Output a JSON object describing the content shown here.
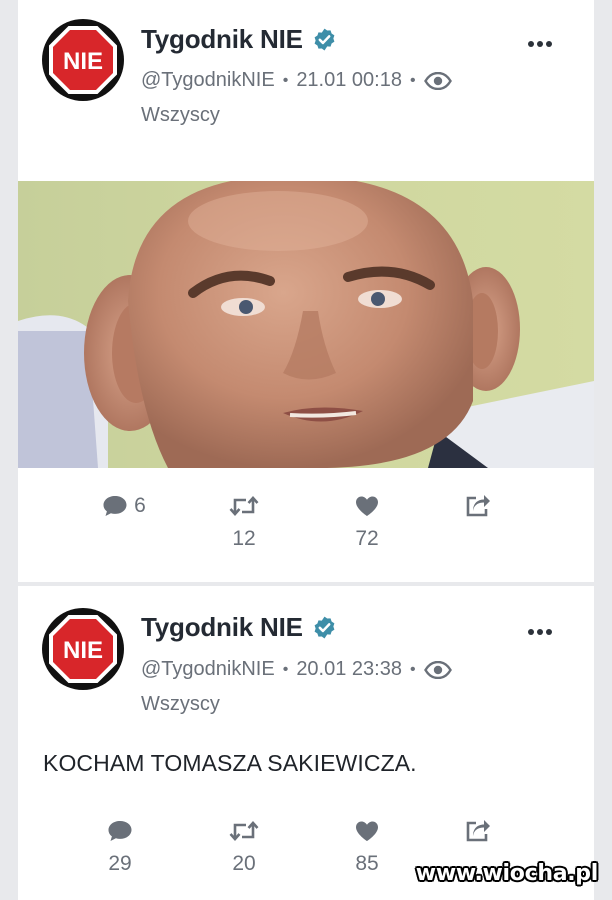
{
  "colors": {
    "background": "#e8e9ec",
    "card": "#ffffff",
    "verified": "#3e8ea8",
    "muted_text": "#6a7079",
    "name_text": "#242a33",
    "stop_sign_red": "#d8262a"
  },
  "posts": [
    {
      "author": "Tygodnik NIE",
      "avatar_text": "NIE",
      "verified_icon": "verified-badge-icon",
      "handle": "@TygodnikNIE",
      "separator": "•",
      "timestamp": "21.01 00:18",
      "visibility_icon": "eye-icon",
      "audience": "Wszyscy",
      "more_icon": "more-dots-icon",
      "media": "photo of a bald man with large ears",
      "actions": {
        "comments": "6",
        "reposts": "12",
        "likes": "72"
      }
    },
    {
      "author": "Tygodnik NIE",
      "avatar_text": "NIE",
      "verified_icon": "verified-badge-icon",
      "handle": "@TygodnikNIE",
      "separator": "•",
      "timestamp": "20.01 23:38",
      "visibility_icon": "eye-icon",
      "audience": "Wszyscy",
      "more_icon": "more-dots-icon",
      "text": "KOCHAM TOMASZA SAKIEWICZA.",
      "actions": {
        "comments": "29",
        "reposts": "20",
        "likes": "85"
      }
    }
  ],
  "watermark": "www.wiocha.pl"
}
